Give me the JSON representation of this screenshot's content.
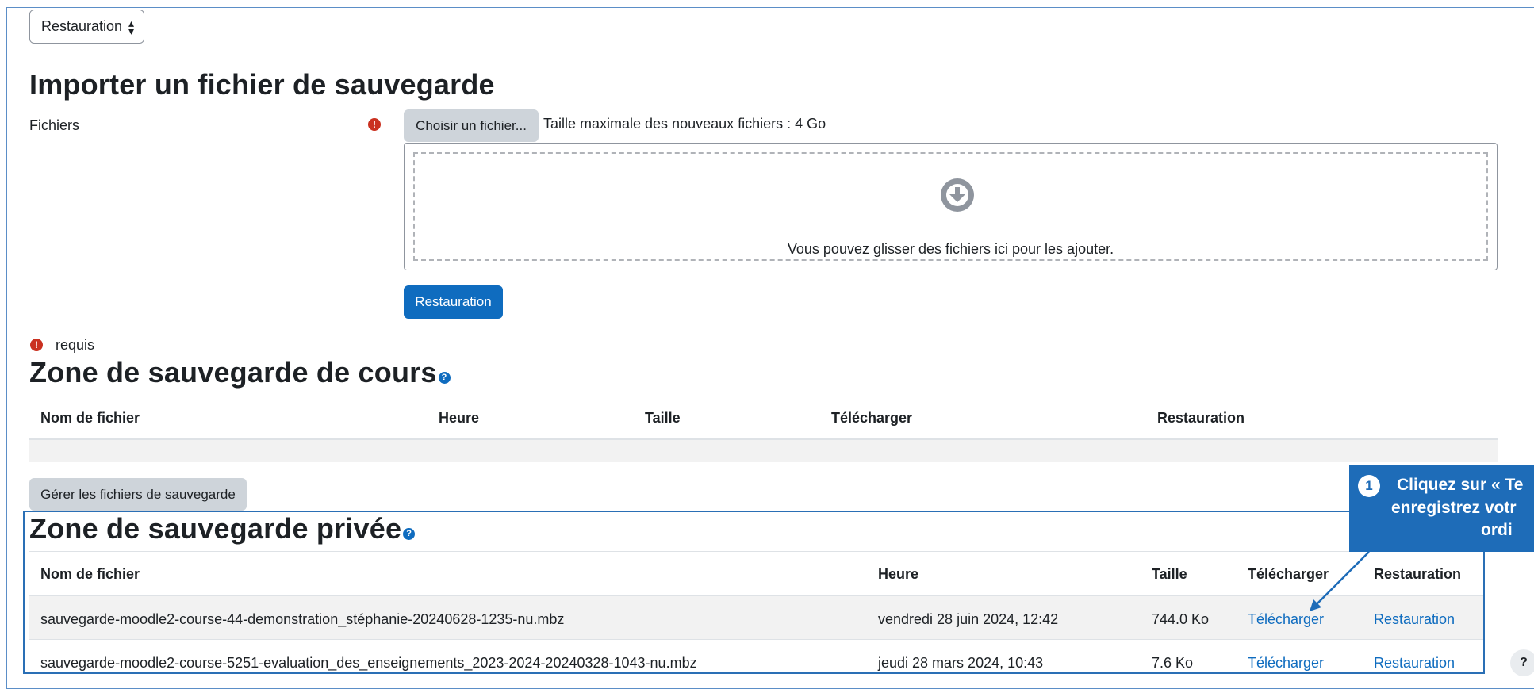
{
  "restore_select": {
    "value": "Restauration"
  },
  "import": {
    "heading": "Importer un fichier de sauvegarde",
    "files_label": "Fichiers",
    "choose_button": "Choisir un fichier...",
    "max_size": "Taille maximale des nouveaux fichiers : 4 Go",
    "drop_text": "Vous pouvez glisser des fichiers ici pour les ajouter.",
    "restore_button": "Restauration",
    "required_text": "requis"
  },
  "course_zone": {
    "heading": "Zone de sauvegarde de cours",
    "columns": [
      "Nom de fichier",
      "Heure",
      "Taille",
      "Télécharger",
      "Restauration"
    ],
    "manage_button": "Gérer les fichiers de sauvegarde"
  },
  "private_zone": {
    "heading": "Zone de sauvegarde privée",
    "columns": [
      "Nom de fichier",
      "Heure",
      "Taille",
      "Télécharger",
      "Restauration"
    ],
    "rows": [
      {
        "filename": "sauvegarde-moodle2-course-44-demonstration_stéphanie-20240628-1235-nu.mbz",
        "time": "vendredi 28 juin 2024, 12:42",
        "size": "744.0 Ko",
        "download": "Télécharger",
        "restore": "Restauration"
      },
      {
        "filename": "sauvegarde-moodle2-course-5251-evaluation_des_enseignements_2023-2024-20240328-1043-nu.mbz",
        "time": "jeudi 28 mars 2024, 10:43",
        "size": "7.6 Ko",
        "download": "Télécharger",
        "restore": "Restauration"
      }
    ]
  },
  "callout": {
    "number": "1",
    "line1": "Cliquez sur « Te",
    "line2": "enregistrez votr",
    "line3": "ordi"
  },
  "help_button": {
    "label": "?"
  },
  "colors": {
    "primary": "#0f6cbf",
    "required": "#ca3120",
    "callout": "#1e6cb8"
  }
}
